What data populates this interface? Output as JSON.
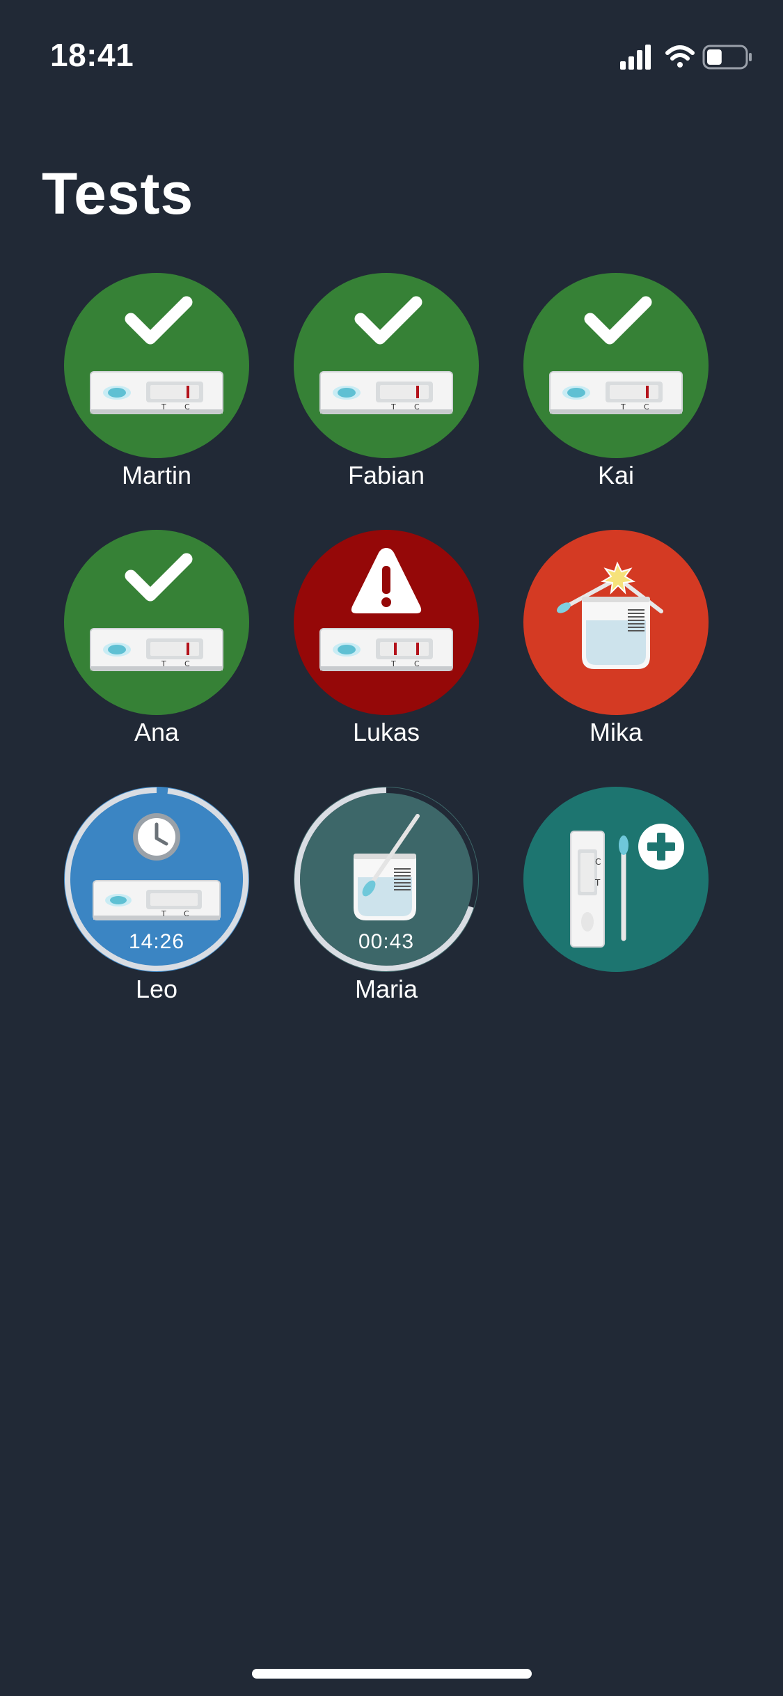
{
  "status_bar": {
    "time": "18:41",
    "icons": [
      "signal-icon",
      "wifi-icon",
      "battery-icon"
    ],
    "battery_level": 0.4
  },
  "title": "Tests",
  "tests": [
    {
      "name": "Martin",
      "status": "negative",
      "color": "#368136",
      "icon": "checkmark-icon"
    },
    {
      "name": "Fabian",
      "status": "negative",
      "color": "#368136",
      "icon": "checkmark-icon"
    },
    {
      "name": "Kai",
      "status": "negative",
      "color": "#368136",
      "icon": "checkmark-icon"
    },
    {
      "name": "Ana",
      "status": "negative",
      "color": "#368136",
      "icon": "checkmark-icon"
    },
    {
      "name": "Lukas",
      "status": "positive",
      "color": "#950808",
      "icon": "warning-icon"
    },
    {
      "name": "Mika",
      "status": "invalid",
      "color": "#D43A23",
      "icon": "broken-swab-icon"
    },
    {
      "name": "Leo",
      "status": "waiting",
      "color": "#3B85C3",
      "icon": "clock-icon",
      "timer": "14:26",
      "progress": 0.02
    },
    {
      "name": "Maria",
      "status": "preparing",
      "color": "#3D6769",
      "icon": "swab-in-tube-icon",
      "timer": "00:43",
      "progress": 0.3
    }
  ],
  "add_test": {
    "color": "#1D7570",
    "icon": "add-test-icon"
  },
  "colors": {
    "background": "#212936",
    "text": "#FFFFFF"
  }
}
